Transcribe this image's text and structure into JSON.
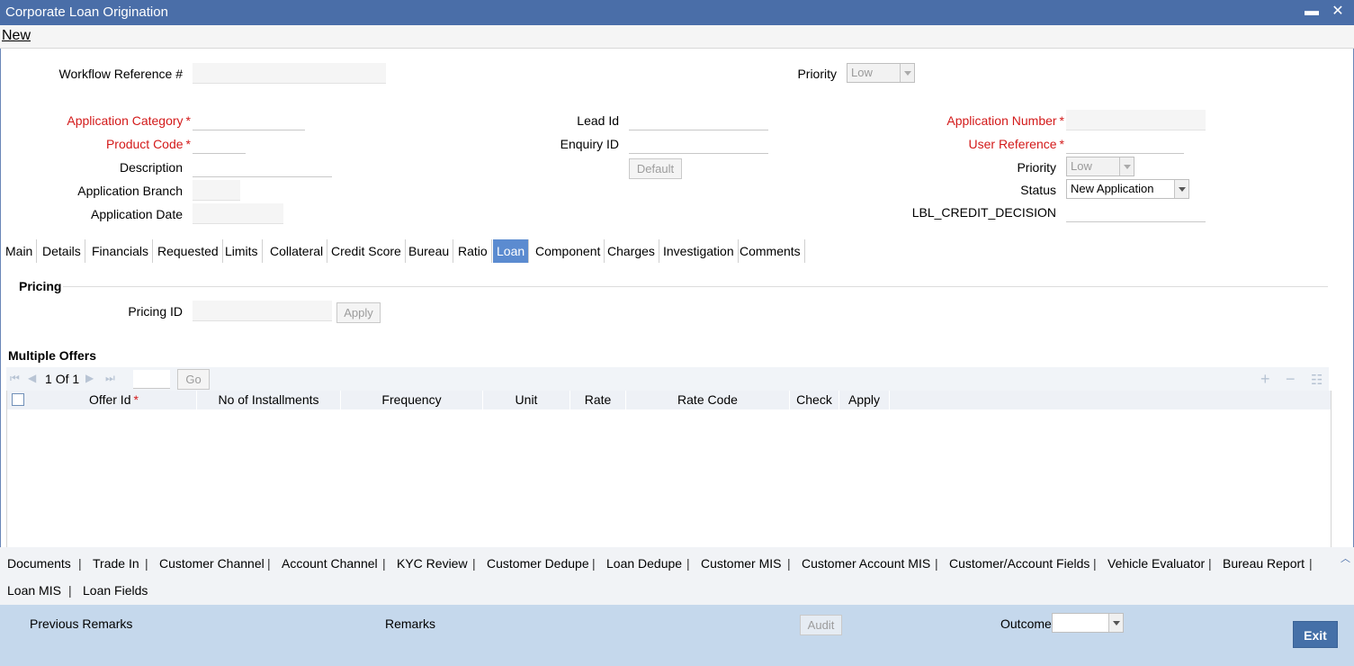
{
  "window": {
    "title": "Corporate Loan Origination",
    "minimize_glyph": "▬",
    "close_glyph": "✕"
  },
  "menu": {
    "new_label": "New"
  },
  "header": {
    "workflow_ref_label": "Workflow Reference #",
    "workflow_ref_value": "",
    "priority_label": "Priority",
    "priority_value": "Low"
  },
  "form": {
    "app_category_label": "Application Category",
    "product_code_label": "Product Code",
    "description_label": "Description",
    "app_branch_label": "Application Branch",
    "app_date_label": "Application Date",
    "lead_id_label": "Lead Id",
    "enquiry_id_label": "Enquiry ID",
    "default_button": "Default",
    "app_number_label": "Application Number",
    "user_ref_label": "User Reference",
    "priority_label": "Priority",
    "priority_value": "Low",
    "status_label": "Status",
    "status_value": "New Application",
    "credit_decision_label": "LBL_CREDIT_DECISION",
    "required_mark": "*"
  },
  "tabs": [
    "Main",
    "Details",
    "Financials",
    "Requested",
    "Limits",
    "Collateral",
    "Credit Score",
    "Bureau",
    "Ratio",
    "Loan",
    "Component",
    "Charges",
    "Investigation",
    "Comments"
  ],
  "active_tab": "Loan",
  "pricing": {
    "section_title": "Pricing",
    "pricing_id_label": "Pricing ID",
    "apply_button": "Apply"
  },
  "offers": {
    "section_title": "Multiple Offers",
    "page_current": "1",
    "page_of": "Of",
    "page_total": "1",
    "go_button": "Go",
    "columns": [
      "Offer Id",
      "No of Installments",
      "Frequency",
      "Unit",
      "Rate",
      "Rate Code",
      "Check",
      "Apply"
    ],
    "add_glyph": "+",
    "remove_glyph": "−",
    "list_glyph": "☷"
  },
  "sublinks": {
    "row1": [
      "Documents",
      "Trade In",
      "Customer Channel",
      "Account Channel",
      "KYC Review",
      "Customer Dedupe",
      "Loan Dedupe",
      "Customer MIS",
      "Customer Account MIS",
      "Customer/Account Fields",
      "Vehicle Evaluator",
      "Bureau Report"
    ],
    "row2": [
      "Loan MIS",
      "Loan Fields"
    ],
    "separator": "|"
  },
  "footer": {
    "previous_remarks_label": "Previous Remarks",
    "remarks_label": "Remarks",
    "audit_button": "Audit",
    "outcome_label": "Outcome",
    "outcome_value": "",
    "exit_button": "Exit"
  },
  "colors": {
    "titlebar": "#4a6ea8",
    "active_tab": "#5b8bd0",
    "required": "#d31a1a",
    "footer": "#c5d8ec",
    "exit_button": "#4570a8"
  }
}
